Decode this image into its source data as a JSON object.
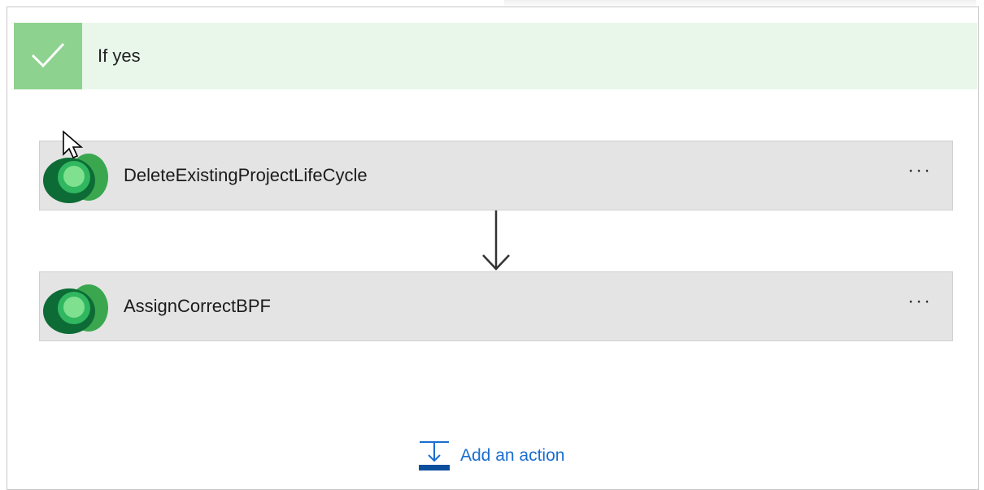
{
  "scope": {
    "title": "If yes"
  },
  "actions": [
    {
      "label": "DeleteExistingProjectLifeCycle",
      "menu": "···"
    },
    {
      "label": "AssignCorrectBPF",
      "menu": "···"
    }
  ],
  "footer": {
    "add_action_label": "Add an action"
  },
  "colors": {
    "header_bg": "#e9f7ea",
    "check_bg": "#8ed28f",
    "card_bg": "#e4e4e4",
    "link": "#1a6dd0"
  },
  "icons": [
    "checkmark-icon",
    "dataverse-icon",
    "more-options-icon",
    "down-arrow-icon",
    "add-action-icon",
    "cursor-icon"
  ]
}
